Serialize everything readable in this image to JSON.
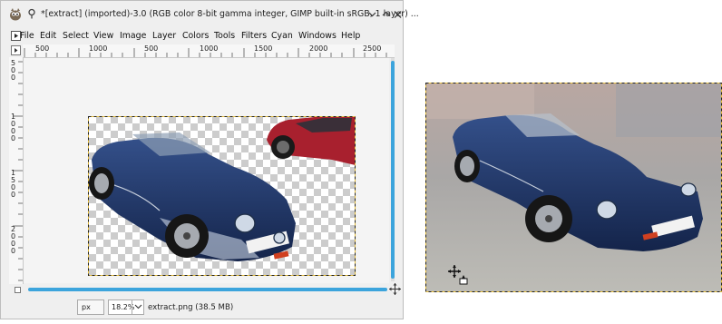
{
  "window": {
    "title": "*[extract] (imported)-3.0 (RGB color 8-bit gamma integer, GIMP built-in sRGB, 1 layer) ..."
  },
  "menu": {
    "items": [
      "File",
      "Edit",
      "Select",
      "View",
      "Image",
      "Layer",
      "Colors",
      "Tools",
      "Filters",
      "Cyan",
      "Windows",
      "Help"
    ]
  },
  "ruler": {
    "h_labels": [
      "500",
      "1000",
      "500",
      "1000",
      "1500",
      "2000",
      "2500"
    ],
    "v_labels": [
      "5",
      "0",
      "0",
      "1",
      "0",
      "0",
      "0",
      "1",
      "5",
      "0",
      "0",
      "2",
      "0",
      "0",
      "0"
    ]
  },
  "status": {
    "unit": "px",
    "zoom": "18.2%",
    "file_info": "extract.png (38.5 MB)"
  },
  "icons": {
    "app": "gimp-wilber-icon",
    "pin": "pin-icon",
    "minimize": "minimize-icon",
    "maximize": "maximize-icon",
    "close": "close-icon",
    "navigate": "navigate-icon",
    "quickmask": "quickmask-icon",
    "move_cursor": "move-cursor-icon"
  },
  "colors": {
    "accent": "#3ca4dc",
    "selection_border": "#e8c040",
    "car_body": "#1c2f5a",
    "red_car": "#a8202e"
  }
}
